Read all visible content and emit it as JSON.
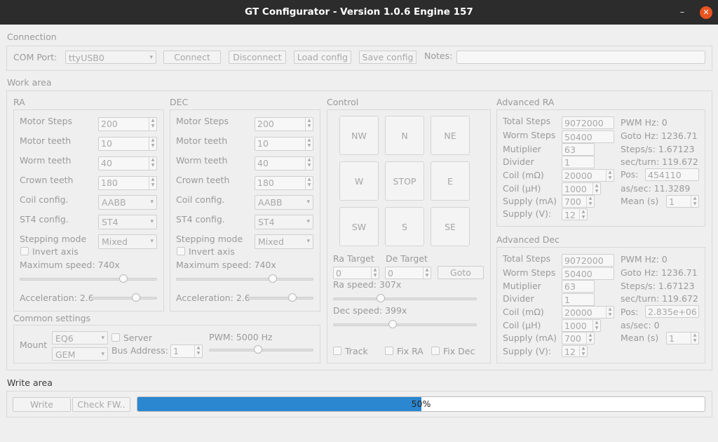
{
  "window": {
    "title": "GT Configurator - Version 1.0.6 Engine 157",
    "minimize": "–",
    "close": "✕"
  },
  "connection": {
    "title": "Connection",
    "com_port_label": "COM Port:",
    "com_port": "ttyUSB0",
    "connect": "Connect",
    "disconnect": "Disconnect",
    "load": "Load config",
    "save": "Save config",
    "notes_label": "Notes:",
    "notes": ""
  },
  "work_area": "Work area",
  "ra": {
    "title": "RA",
    "motor_steps_label": "Motor Steps",
    "motor_steps": "200",
    "motor_teeth_label": "Motor teeth",
    "motor_teeth": "10",
    "worm_teeth_label": "Worm teeth",
    "worm_teeth": "40",
    "crown_teeth_label": "Crown teeth",
    "crown_teeth": "180",
    "coil_label": "Coil config.",
    "coil": "AABB",
    "st4_label": "ST4 config.",
    "st4": "ST4",
    "stepping_label": "Stepping mode",
    "stepping": "Mixed",
    "invert_label": "Invert axis",
    "maxspeed_label": "Maximum speed: 740x",
    "accel_label": "Acceleration: 2.6",
    "maxspeed_pct": 0.77,
    "accel_pct": 0.71
  },
  "dec": {
    "title": "DEC",
    "motor_steps_label": "Motor Steps",
    "motor_steps": "200",
    "motor_teeth_label": "Motor teeth",
    "motor_teeth": "10",
    "worm_teeth_label": "Worm teeth",
    "worm_teeth": "40",
    "crown_teeth_label": "Crown teeth",
    "crown_teeth": "180",
    "coil_label": "Coil config.",
    "coil": "AABB",
    "st4_label": "ST4 config.",
    "st4": "ST4",
    "stepping_label": "Stepping mode",
    "stepping": "Mixed",
    "invert_label": "Invert axis",
    "maxspeed_label": "Maximum speed: 740x",
    "accel_label": "Acceleration: 2.6",
    "maxspeed_pct": 0.72,
    "accel_pct": 0.71
  },
  "common": {
    "title": "Common settings",
    "mount_label": "Mount",
    "mount": "EQ6",
    "mount_type": "GEM",
    "server_label": "Server",
    "bus_label": "Bus Address:",
    "bus": "1",
    "pwm_label": "PWM: 5000 Hz",
    "pwm_pct": 0.47
  },
  "control": {
    "title": "Control",
    "buttons": [
      "NW",
      "N",
      "NE",
      "W",
      "STOP",
      "E",
      "SW",
      "S",
      "SE"
    ],
    "ra_target_label": "Ra Target",
    "ra_target": "0",
    "de_target_label": "De Target",
    "de_target": "0",
    "goto": "Goto",
    "ra_speed_label": "Ra speed: 307x",
    "ra_speed_pct": 0.32,
    "dec_speed_label": "Dec speed: 399x",
    "dec_speed_pct": 0.41,
    "track_label": "Track",
    "fixra_label": "Fix RA",
    "fixdec_label": "Fix Dec"
  },
  "adv_ra": {
    "title": "Advanced RA",
    "total_steps_label": "Total Steps",
    "total_steps": "9072000",
    "worm_steps_label": "Worm Steps",
    "worm_steps": "50400",
    "multiplier_label": "Mutiplier",
    "multiplier": "63",
    "divider_label": "Divider",
    "divider": "1",
    "coil_mohm_label": "Coil (mΩ)",
    "coil_mohm": "20000",
    "coil_uh_label": "Coil (μH)",
    "coil_uh": "1000",
    "supply_ma_label": "Supply (mA)",
    "supply_ma": "700",
    "supply_v_label": "Supply (V):",
    "supply_v": "12",
    "pwm_hz": "PWM Hz: 0",
    "goto_hz": "Goto Hz: 1236.71",
    "steps_s": "Steps/s: 1.67123",
    "sec_turn": "sec/turn: 119.672",
    "pos_label": "Pos:",
    "pos": "454110",
    "as_sec": "as/sec: 11.3289",
    "mean_label": "Mean (s)",
    "mean": "1"
  },
  "adv_dec": {
    "title": "Advanced Dec",
    "total_steps_label": "Total Steps",
    "total_steps": "9072000",
    "worm_steps_label": "Worm Steps",
    "worm_steps": "50400",
    "multiplier_label": "Mutiplier",
    "multiplier": "63",
    "divider_label": "Divider",
    "divider": "1",
    "coil_mohm_label": "Coil (mΩ)",
    "coil_mohm": "20000",
    "coil_uh_label": "Coil (μH)",
    "coil_uh": "1000",
    "supply_ma_label": "Supply (mA)",
    "supply_ma": "700",
    "supply_v_label": "Supply (V):",
    "supply_v": "12",
    "pwm_hz": "PWM Hz: 0",
    "goto_hz": "Goto Hz: 1236.71",
    "steps_s": "Steps/s: 1.67123",
    "sec_turn": "sec/turn: 119.672",
    "pos_label": "Pos:",
    "pos": "2.835e+06",
    "as_sec": "as/sec: 0",
    "mean_label": "Mean (s)",
    "mean": "1"
  },
  "write": {
    "title": "Write area",
    "write": "Write",
    "check_fw": "Check FW..",
    "progress_text": "50%",
    "progress_value": 0.5
  },
  "colors": {
    "accent": "#2a87d0",
    "close": "#e95420",
    "titlebar": "#2c2c2c"
  }
}
